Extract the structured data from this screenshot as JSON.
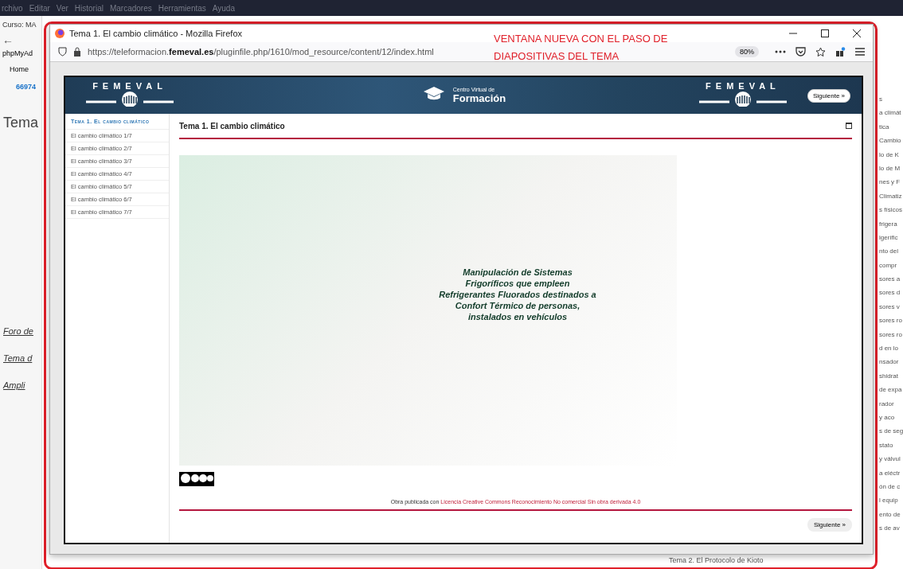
{
  "os_menu": [
    "rchivo",
    "Editar",
    "Ver",
    "Historial",
    "Marcadores",
    "Herramientas",
    "Ayuda"
  ],
  "background_page": {
    "tab_title": "Curso: MA",
    "nav_back": "←",
    "bookmark": "phpMyAd",
    "nav_home": "Home",
    "phone": "66974",
    "heading": "Tema",
    "sections": [
      "Foro de",
      "Tema d",
      "Ampli"
    ],
    "right_list": [
      "s",
      "a climát",
      "tica",
      "Cambio",
      "lo de K",
      "lo de M",
      "nes y F",
      "Climatiz",
      "s físicos",
      "frigera",
      "igerífic",
      "nto del",
      "compr",
      "sores a",
      "sores d",
      "sores v",
      "sores ro",
      "sores ro",
      "d en lo",
      "nsador",
      "shidrat",
      "de expa",
      "rador",
      "y aco",
      "s de seg",
      "stato",
      "y válvul",
      "a eléctr",
      "ón de c",
      "l equip",
      "ento de",
      "s de av"
    ],
    "footer_link": "Tema 2. El Protocolo de Kioto"
  },
  "annotation": {
    "text": [
      "VENTANA NUEVA CON EL PASO DE",
      "DIAPOSITIVAS DEL TEMA"
    ]
  },
  "window": {
    "title": "Tema 1. El cambio climático - Mozilla Firefox",
    "url_prefix": "https://teleformacion.",
    "url_domain": "femeval.es",
    "url_rest": "/pluginfile.php/1610/mod_resource/content/12/index.html",
    "zoom": "80%"
  },
  "header": {
    "logo_left": "FEMEVAL",
    "center_small": "Centro Virtual de",
    "center_big": "Formación",
    "logo_right": "FEMEVAL",
    "next_button": "Siguiente »"
  },
  "sidebar": {
    "title": "Tema 1. El cambio climático",
    "items": [
      {
        "label": "El cambio climático 1/7",
        "selected": false
      },
      {
        "label": "El cambio climático 2/7",
        "selected": false
      },
      {
        "label": "El cambio climático 3/7",
        "selected": false
      },
      {
        "label": "El cambio climático 4/7",
        "selected": false
      },
      {
        "label": "El cambio climático 5/7",
        "selected": false
      },
      {
        "label": "El cambio climático 6/7",
        "selected": false
      },
      {
        "label": "El cambio climático 7/7",
        "selected": false
      }
    ]
  },
  "content": {
    "title": "Tema 1. El cambio climático",
    "image_caption": "Manipulación de Sistemas Frigoríficos que empleen Refrigerantes Fluorados destinados a Confort Térmico de personas, instalados en vehículos",
    "license_prefix": "Obra publicada con ",
    "license_link": "Licencia Creative Commons Reconocimiento No comercial Sin obra derivada 4.0",
    "next_button": "Siguiente »"
  }
}
